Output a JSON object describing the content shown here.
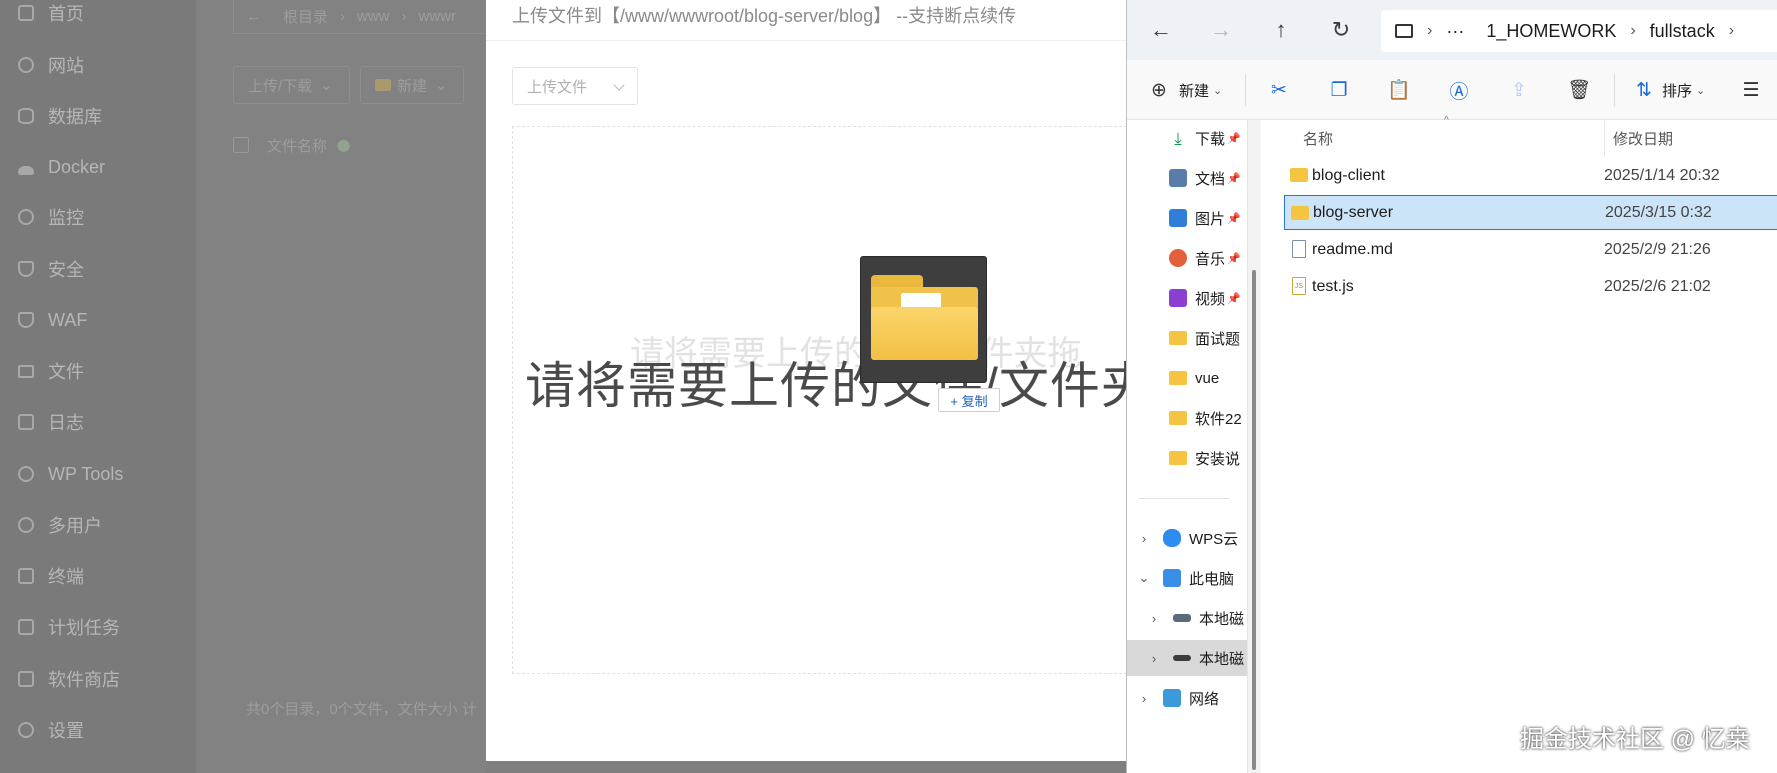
{
  "sidebar": {
    "items": [
      {
        "label": "首页",
        "icon": "home-icon"
      },
      {
        "label": "网站",
        "icon": "globe-icon"
      },
      {
        "label": "数据库",
        "icon": "database-icon"
      },
      {
        "label": "Docker",
        "icon": "docker-icon"
      },
      {
        "label": "监控",
        "icon": "monitor-icon"
      },
      {
        "label": "安全",
        "icon": "shield-icon"
      },
      {
        "label": "WAF",
        "icon": "waf-icon"
      },
      {
        "label": "文件",
        "icon": "folder-icon"
      },
      {
        "label": "日志",
        "icon": "log-icon"
      },
      {
        "label": "WP Tools",
        "icon": "wordpress-icon"
      },
      {
        "label": "多用户",
        "icon": "users-icon"
      },
      {
        "label": "终端",
        "icon": "terminal-icon"
      },
      {
        "label": "计划任务",
        "icon": "clock-icon"
      },
      {
        "label": "软件商店",
        "icon": "store-icon"
      },
      {
        "label": "设置",
        "icon": "gear-icon"
      }
    ]
  },
  "file_manager": {
    "breadcrumb": [
      "根目录",
      "www",
      "wwwr"
    ],
    "upload_download_label": "上传/下载",
    "new_label": "新建",
    "column_filename": "文件名称",
    "footer": "共0个目录，0个文件，文件大小  计"
  },
  "upload_dialog": {
    "title": "上传文件到【/www/wwwroot/blog-server/blog】 --支持断点续传",
    "select_label": "上传文件",
    "drop_hint": "请将需要上传的文件/文件夹",
    "drop_hint_ghost": "请将需要上传的文件/文件夹拖",
    "copy_badge": "+ 复制"
  },
  "explorer": {
    "address": {
      "more": "···",
      "segments": [
        "1_HOMEWORK",
        "fullstack"
      ]
    },
    "commands": {
      "new_label": "新建",
      "sort_label": "排序"
    },
    "nav": {
      "quick_access": [
        {
          "label": "下载",
          "type": "download"
        },
        {
          "label": "文档",
          "type": "doc"
        },
        {
          "label": "图片",
          "type": "image"
        },
        {
          "label": "音乐",
          "type": "music"
        },
        {
          "label": "视频",
          "type": "video"
        },
        {
          "label": "面试题",
          "type": "folder"
        },
        {
          "label": "vue",
          "type": "folder"
        },
        {
          "label": "软件22",
          "type": "folder"
        },
        {
          "label": "安装说",
          "type": "folder"
        }
      ],
      "tree": [
        {
          "label": "WPS云",
          "expand": "›"
        },
        {
          "label": "此电脑",
          "expand": "⌄"
        },
        {
          "label": "本地磁",
          "expand": "›"
        },
        {
          "label": "本地磁",
          "expand": "›"
        },
        {
          "label": "网络",
          "expand": "›"
        }
      ]
    },
    "columns": {
      "name": "名称",
      "modified": "修改日期"
    },
    "files": [
      {
        "name": "blog-client",
        "date": "2025/1/14 20:32",
        "type": "folder"
      },
      {
        "name": "blog-server",
        "date": "2025/3/15 0:32",
        "type": "folder"
      },
      {
        "name": "readme.md",
        "date": "2025/2/9 21:26",
        "type": "doc"
      },
      {
        "name": "test.js",
        "date": "2025/2/6 21:02",
        "type": "js"
      }
    ]
  },
  "watermark": "掘金技术社区 @ 忆桒"
}
